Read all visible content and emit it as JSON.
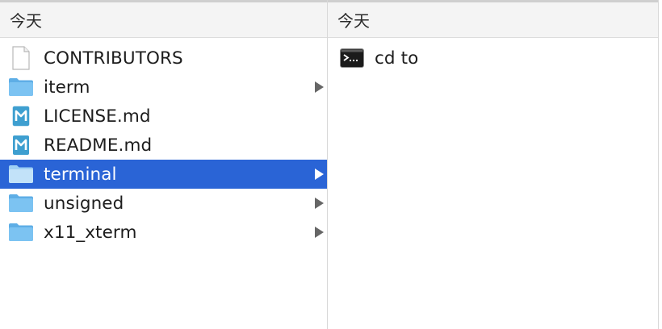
{
  "left_column": {
    "header": "今天",
    "items": [
      {
        "label": "CONTRIBUTORS",
        "icon": "document-icon",
        "has_children": false,
        "selected": false
      },
      {
        "label": "iterm",
        "icon": "folder-icon",
        "has_children": true,
        "selected": false
      },
      {
        "label": "LICENSE.md",
        "icon": "markdown-file-icon",
        "has_children": false,
        "selected": false
      },
      {
        "label": "README.md",
        "icon": "markdown-file-icon",
        "has_children": false,
        "selected": false
      },
      {
        "label": "terminal",
        "icon": "folder-icon",
        "has_children": true,
        "selected": true
      },
      {
        "label": "unsigned",
        "icon": "folder-icon",
        "has_children": true,
        "selected": false
      },
      {
        "label": "x11_xterm",
        "icon": "folder-icon",
        "has_children": true,
        "selected": false
      }
    ]
  },
  "right_column": {
    "header": "今天",
    "items": [
      {
        "label": "cd to",
        "icon": "terminal-app-icon"
      }
    ]
  },
  "colors": {
    "selection": "#2a64d6",
    "folder": "#6cb8ee",
    "markdown": "#2e8fc4"
  }
}
